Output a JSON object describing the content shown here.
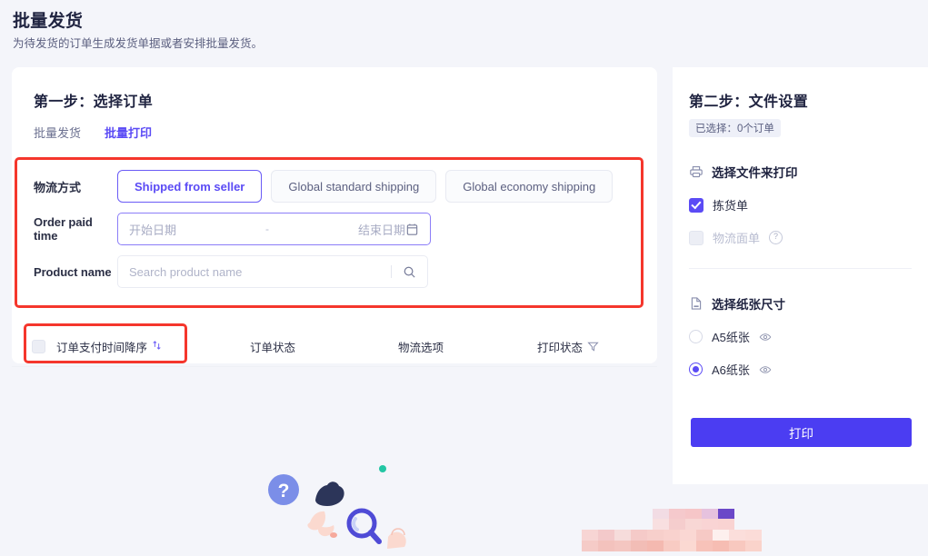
{
  "header": {
    "title": "批量发货",
    "subtitle": "为待发货的订单生成发货单据或者安排批量发货。"
  },
  "left": {
    "step_title": "第一步：选择订单",
    "tabs": [
      {
        "label": "批量发货",
        "active": false
      },
      {
        "label": "批量打印",
        "active": true
      }
    ],
    "filters": {
      "shipping": {
        "label": "物流方式",
        "options": [
          {
            "label": "Shipped from seller",
            "active": true
          },
          {
            "label": "Global standard shipping",
            "active": false
          },
          {
            "label": "Global economy shipping",
            "active": false
          }
        ]
      },
      "paid_time": {
        "label": "Order paid time",
        "start_placeholder": "开始日期",
        "separator": "-",
        "end_placeholder": "结束日期",
        "icon": "calendar-icon"
      },
      "product": {
        "label": "Product name",
        "placeholder": "Search product name",
        "icon": "search-icon"
      }
    },
    "table": {
      "columns": [
        {
          "label": "订单支付时间降序",
          "icon": "sort-icon"
        },
        {
          "label": "订单状态",
          "icon": ""
        },
        {
          "label": "物流选项",
          "icon": ""
        },
        {
          "label": "打印状态",
          "icon": "filter-funnel-icon"
        }
      ],
      "select_all_checked": false
    },
    "empty_illustration": "person-with-magnifier-question-illustration"
  },
  "right": {
    "step_title": "第二步：文件设置",
    "selected_badge": "已选择：0个订单",
    "file_section": {
      "icon": "printer-icon",
      "title": "选择文件来打印",
      "options": [
        {
          "label": "拣货单",
          "checked": true,
          "disabled": false,
          "help": false
        },
        {
          "label": "物流面单",
          "checked": false,
          "disabled": true,
          "help": true,
          "help_icon": "question-mark-icon"
        }
      ]
    },
    "paper_section": {
      "icon": "document-a4-icon",
      "title": "选择纸张尺寸",
      "options": [
        {
          "label": "A5纸张",
          "selected": false,
          "preview_icon": "eye-icon"
        },
        {
          "label": "A6纸张",
          "selected": true,
          "preview_icon": "eye-icon"
        }
      ]
    },
    "print_button": "打印"
  },
  "annotations": {
    "filter_box_color": "#f5362c",
    "header_box_color": "#f5362c"
  },
  "colors": {
    "accent": "#5b4bf5",
    "button": "#4b3df2",
    "page_bg": "#f4f5fa",
    "card_bg": "#ffffff",
    "text": "#2b2f45",
    "muted": "#6b7090"
  }
}
